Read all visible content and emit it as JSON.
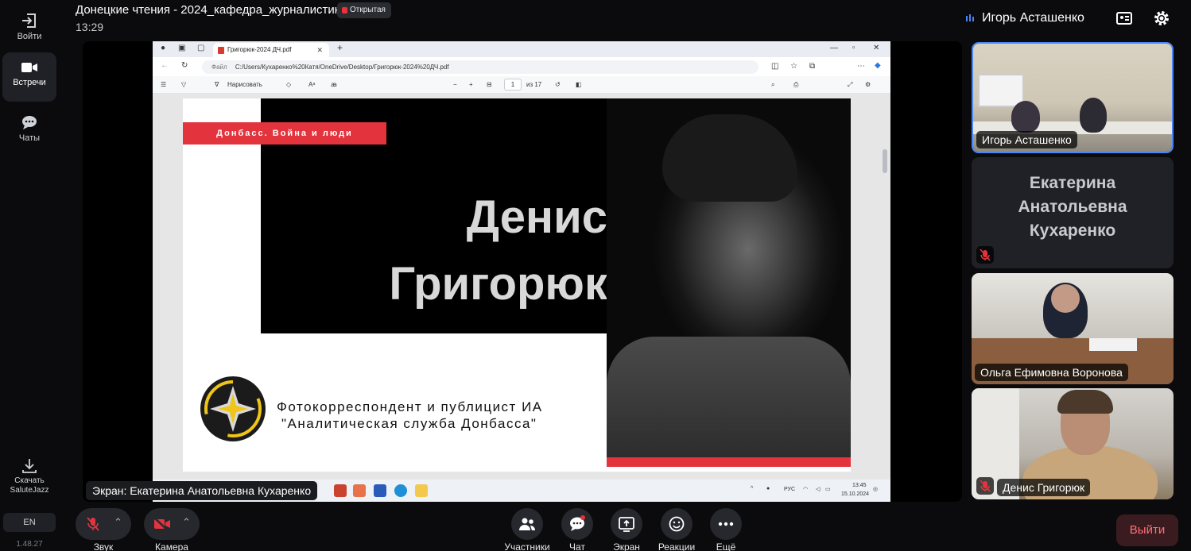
{
  "meeting": {
    "title": "Донецкие чтения - 2024_кафедра_журналистики",
    "badge": "Открытая",
    "time": "13:29"
  },
  "user": {
    "name": "Игорь Асташенко"
  },
  "rail": {
    "items": [
      {
        "label": "Войти",
        "icon": "login-icon"
      },
      {
        "label": "Встречи",
        "icon": "video-camera-icon",
        "active": true
      },
      {
        "label": "Чаты",
        "icon": "chat-icon"
      }
    ],
    "download_label": "Скачать SaluteJazz",
    "lang": "EN",
    "version": "1.48.27"
  },
  "shared_screen": {
    "label": "Экран: Екатерина Анатольевна Кухаренко",
    "browser": {
      "tab_title": "Григорюк-2024 ДЧ.pdf",
      "url_label": "Файл",
      "url": "C:/Users/Кухаренко%20Катя/OneDrive/Desktop/Григорюк-2024%20ДЧ.pdf",
      "draw_label": "Нарисовать",
      "page_current": "1",
      "page_total": "из 17"
    },
    "slide": {
      "tag": "Донбасс. Война и люди",
      "name_line1": "Денис",
      "name_line2": "Григорюк",
      "caption_line1": "Фотокорреспондент и публицист ИА",
      "caption_line2": "\"Аналитическая служба Донбасса\""
    },
    "taskbar": {
      "lang": "РУС",
      "time": "13:45",
      "date": "15.10.2024"
    }
  },
  "participants": [
    {
      "name": "Игорь Асташенко",
      "active": true
    },
    {
      "name": "Екатерина Анатольевна Кухаренко",
      "display_lines": [
        "Екатерина",
        "Анатольевна",
        "Кухаренко"
      ],
      "muted": true
    },
    {
      "name": "Ольга Ефимовна Воронова"
    },
    {
      "name": "Денис Григорюк",
      "muted": true
    }
  ],
  "controls": {
    "sound": "Звук",
    "camera": "Камера",
    "participants": "Участники",
    "chat": "Чат",
    "screen": "Экран",
    "reactions": "Реакции",
    "more": "Ещё",
    "exit": "Выйти"
  },
  "colors": {
    "accent": "#4a84f5",
    "danger": "#e3333d",
    "exit_text": "#ff6f77"
  }
}
